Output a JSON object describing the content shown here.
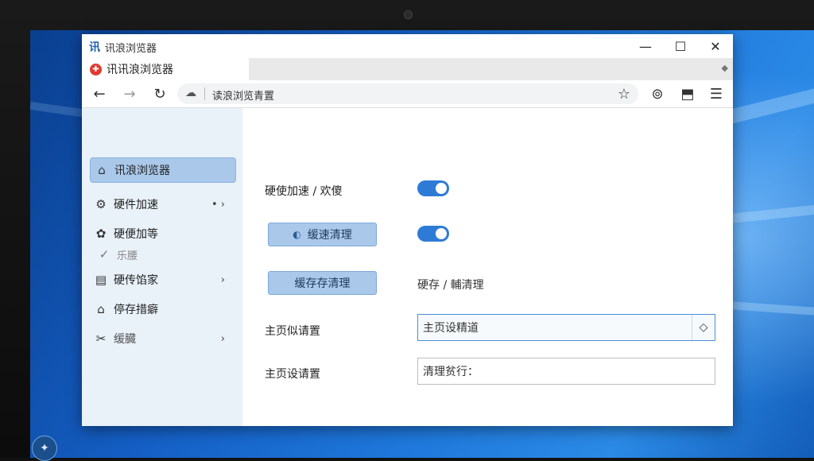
{
  "window": {
    "logo_text": "讯",
    "title": "讯浪浏览器",
    "controls": {
      "minimize": "—",
      "maximize": "☐",
      "close": "✕"
    }
  },
  "tab": {
    "label": "讯讯浪浏览器",
    "icon_glyph": "✚",
    "more_glyph": "◆"
  },
  "toolbar": {
    "back": "←",
    "forward": "→",
    "reload": "↻",
    "address_icon": "☁",
    "address_text": "读浪浏览青置",
    "star": "☆",
    "profile": "⊚",
    "extensions": "⬒",
    "menu": "☰"
  },
  "sidebar": {
    "items": [
      {
        "icon": "home-icon",
        "glyph": "⌂",
        "label": "讯浪浏览器",
        "active": true
      },
      {
        "icon": "gear-icon",
        "glyph": "⚙",
        "label": "硬件加速",
        "trail": "• ›"
      },
      {
        "icon": "cog-icon",
        "glyph": "✿",
        "label": "硬便加等"
      },
      {
        "icon": "document-icon",
        "glyph": "▤",
        "label": "硬传馅家",
        "trail": "›"
      },
      {
        "icon": "home-outline-icon",
        "glyph": "⌂",
        "label": "停存措癖"
      },
      {
        "icon": "tools-icon",
        "glyph": "✂",
        "label": "缓臓",
        "trail": "›"
      }
    ],
    "sub_item": {
      "glyph": "✓",
      "label": "乐腰"
    }
  },
  "content": {
    "row1_label": "硬使加速 / 欢傻",
    "cache_button_label": "缓速清理",
    "cache_button_icon": "◐",
    "cache_store_button_label": "缓存存清理",
    "cache_store_text": "硬存 / 輔清理",
    "homepage_label_1": "主页似请置",
    "homepage_value": "主页设精道",
    "homepage_dropdown_glyph": "◇",
    "homepage_label_2": "主页设请置",
    "clear_field_value": "清理贫行："
  },
  "desktop": {
    "start_glyph": "✦"
  },
  "colors": {
    "accent": "#2e7bd6",
    "sidebar_bg": "#e9f1f9",
    "button_bg": "#a9c8ea"
  }
}
